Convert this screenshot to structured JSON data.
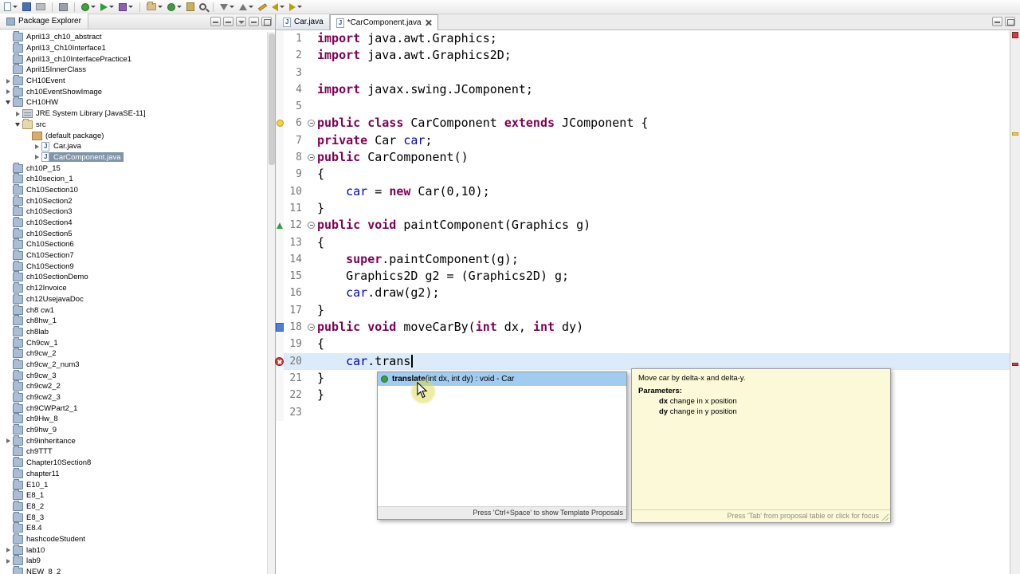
{
  "toolbar": {
    "icons": [
      {
        "name": "new-wizard-button",
        "kind": "doc",
        "dd": true
      },
      {
        "name": "save-button",
        "kind": "disk"
      },
      {
        "name": "print-button",
        "kind": "printer"
      },
      {
        "sep": true
      },
      {
        "name": "build-all-button",
        "kind": "hammer"
      },
      {
        "sep": true
      },
      {
        "name": "debug-button",
        "kind": "bug",
        "dd": true
      },
      {
        "name": "run-button",
        "kind": "play",
        "dd": true
      },
      {
        "name": "profile-button",
        "kind": "profile",
        "dd": true
      },
      {
        "sep": true
      },
      {
        "name": "new-java-project-button",
        "kind": "folder",
        "dd": true
      },
      {
        "name": "new-class-button",
        "kind": "class",
        "dd": true
      },
      {
        "name": "open-type-button",
        "kind": "jar"
      },
      {
        "name": "search-button",
        "kind": "search"
      },
      {
        "sep": true
      },
      {
        "name": "next-annotation-button",
        "kind": "arrow-down",
        "dd": true
      },
      {
        "name": "prev-annotation-button",
        "kind": "arrow-up",
        "dd": true
      },
      {
        "name": "last-edit-location-button",
        "kind": "pencil"
      },
      {
        "name": "back-button",
        "kind": "arrow-left",
        "dd": true
      },
      {
        "name": "forward-button",
        "kind": "arrow-right",
        "dd": true
      }
    ]
  },
  "package_explorer": {
    "title": "Package Explorer",
    "items": [
      {
        "label": "April13_ch10_abstract",
        "depth": 0,
        "icon": "project"
      },
      {
        "label": "April13_Ch10Interface1",
        "depth": 0,
        "icon": "project"
      },
      {
        "label": "April13_ch10InterfacePractice1",
        "depth": 0,
        "icon": "project"
      },
      {
        "label": "April15InnerClass",
        "depth": 0,
        "icon": "project"
      },
      {
        "label": "CH10Event",
        "depth": 0,
        "icon": "project",
        "arrow": "right"
      },
      {
        "label": "ch10EventShowImage",
        "depth": 0,
        "icon": "project",
        "arrow": "right"
      },
      {
        "label": "CH10HW",
        "depth": 0,
        "icon": "project",
        "arrow": "down"
      },
      {
        "label": "JRE System Library [JavaSE-11]",
        "depth": 1,
        "icon": "lib",
        "arrow": "right"
      },
      {
        "label": "src",
        "depth": 1,
        "icon": "src",
        "arrow": "down"
      },
      {
        "label": "(default package)",
        "depth": 2,
        "icon": "pkg"
      },
      {
        "label": "Car.java",
        "depth": 3,
        "icon": "jfile",
        "arrow": "right"
      },
      {
        "label": "CarComponent.java",
        "depth": 3,
        "icon": "jfile",
        "arrow": "right",
        "selected": true
      },
      {
        "label": "ch10P_15",
        "depth": 0,
        "icon": "project"
      },
      {
        "label": "ch10secion_1",
        "depth": 0,
        "icon": "project"
      },
      {
        "label": "Ch10Section10",
        "depth": 0,
        "icon": "project"
      },
      {
        "label": "ch10Section2",
        "depth": 0,
        "icon": "project"
      },
      {
        "label": "ch10Section3",
        "depth": 0,
        "icon": "project"
      },
      {
        "label": "ch10Section4",
        "depth": 0,
        "icon": "project"
      },
      {
        "label": "ch10Section5",
        "depth": 0,
        "icon": "project"
      },
      {
        "label": "Ch10Section6",
        "depth": 0,
        "icon": "project"
      },
      {
        "label": "Ch10Section7",
        "depth": 0,
        "icon": "project"
      },
      {
        "label": "Ch10Section9",
        "depth": 0,
        "icon": "project"
      },
      {
        "label": "ch10SectionDemo",
        "depth": 0,
        "icon": "project"
      },
      {
        "label": "ch12Invoice",
        "depth": 0,
        "icon": "project"
      },
      {
        "label": "ch12UsejavaDoc",
        "depth": 0,
        "icon": "project"
      },
      {
        "label": "ch8 cw1",
        "depth": 0,
        "icon": "project"
      },
      {
        "label": "ch8hw_1",
        "depth": 0,
        "icon": "project"
      },
      {
        "label": "ch8lab",
        "depth": 0,
        "icon": "project"
      },
      {
        "label": "Ch9cw_1",
        "depth": 0,
        "icon": "project"
      },
      {
        "label": "ch9cw_2",
        "depth": 0,
        "icon": "project"
      },
      {
        "label": "ch9cw_2_num3",
        "depth": 0,
        "icon": "project"
      },
      {
        "label": "ch9cw_3",
        "depth": 0,
        "icon": "project"
      },
      {
        "label": "ch9cw2_2",
        "depth": 0,
        "icon": "project"
      },
      {
        "label": "ch9cw2_3",
        "depth": 0,
        "icon": "project"
      },
      {
        "label": "ch9CWPart2_1",
        "depth": 0,
        "icon": "project"
      },
      {
        "label": "ch9Hw_8",
        "depth": 0,
        "icon": "project"
      },
      {
        "label": "ch9hw_9",
        "depth": 0,
        "icon": "project"
      },
      {
        "label": "ch9inheritance",
        "depth": 0,
        "icon": "project",
        "arrow": "right"
      },
      {
        "label": "ch9TTT",
        "depth": 0,
        "icon": "project"
      },
      {
        "label": "Chapter10Section8",
        "depth": 0,
        "icon": "project"
      },
      {
        "label": "chapter11",
        "depth": 0,
        "icon": "project"
      },
      {
        "label": "E10_1",
        "depth": 0,
        "icon": "project"
      },
      {
        "label": "E8_1",
        "depth": 0,
        "icon": "project"
      },
      {
        "label": "E8_2",
        "depth": 0,
        "icon": "project"
      },
      {
        "label": "E8_3",
        "depth": 0,
        "icon": "project"
      },
      {
        "label": "E8.4",
        "depth": 0,
        "icon": "project"
      },
      {
        "label": "hashcodeStudent",
        "depth": 0,
        "icon": "project"
      },
      {
        "label": "lab10",
        "depth": 0,
        "icon": "project",
        "arrow": "right"
      },
      {
        "label": "lab9",
        "depth": 0,
        "icon": "project",
        "arrow": "right"
      },
      {
        "label": "NEW_8_2",
        "depth": 0,
        "icon": "project"
      }
    ]
  },
  "editor": {
    "tabs": [
      {
        "label": "Car.java",
        "active": false
      },
      {
        "label": "*CarComponent.java",
        "active": true
      }
    ],
    "lines": [
      {
        "n": 1,
        "tokens": [
          {
            "t": "k",
            "s": "import"
          },
          {
            "t": "p",
            "s": " java.awt.Graphics;"
          }
        ]
      },
      {
        "n": 2,
        "tokens": [
          {
            "t": "k",
            "s": "import"
          },
          {
            "t": "p",
            "s": " java.awt.Graphics2D;"
          }
        ]
      },
      {
        "n": 3,
        "tokens": []
      },
      {
        "n": 4,
        "tokens": [
          {
            "t": "k",
            "s": "import"
          },
          {
            "t": "p",
            "s": " javax.swing.JComponent;"
          }
        ]
      },
      {
        "n": 5,
        "tokens": []
      },
      {
        "n": 6,
        "tokens": [
          {
            "t": "k",
            "s": "public"
          },
          {
            "t": "p",
            "s": " "
          },
          {
            "t": "k",
            "s": "class"
          },
          {
            "t": "p",
            "s": " CarComponent "
          },
          {
            "t": "k",
            "s": "extends"
          },
          {
            "t": "p",
            "s": " JComponent {"
          }
        ],
        "fold": true,
        "marker": "warning"
      },
      {
        "n": 7,
        "tokens": [
          {
            "t": "k",
            "s": "private"
          },
          {
            "t": "p",
            "s": " Car "
          },
          {
            "t": "f",
            "s": "car"
          },
          {
            "t": "p",
            "s": ";"
          }
        ]
      },
      {
        "n": 8,
        "tokens": [
          {
            "t": "k",
            "s": "public"
          },
          {
            "t": "p",
            "s": " CarComponent()"
          }
        ],
        "fold": true
      },
      {
        "n": 9,
        "tokens": [
          {
            "t": "p",
            "s": "{"
          }
        ]
      },
      {
        "n": 10,
        "tokens": [
          {
            "t": "p",
            "s": "    "
          },
          {
            "t": "f",
            "s": "car"
          },
          {
            "t": "p",
            "s": " = "
          },
          {
            "t": "k",
            "s": "new"
          },
          {
            "t": "p",
            "s": " Car(0,10);"
          }
        ]
      },
      {
        "n": 11,
        "tokens": [
          {
            "t": "p",
            "s": "}"
          }
        ]
      },
      {
        "n": 12,
        "tokens": [
          {
            "t": "k",
            "s": "public"
          },
          {
            "t": "p",
            "s": " "
          },
          {
            "t": "k",
            "s": "void"
          },
          {
            "t": "p",
            "s": " paintComponent(Graphics g)"
          }
        ],
        "fold": true,
        "marker": "override"
      },
      {
        "n": 13,
        "tokens": [
          {
            "t": "p",
            "s": "{"
          }
        ]
      },
      {
        "n": 14,
        "tokens": [
          {
            "t": "p",
            "s": "    "
          },
          {
            "t": "k",
            "s": "super"
          },
          {
            "t": "p",
            "s": ".paintComponent(g);"
          }
        ]
      },
      {
        "n": 15,
        "tokens": [
          {
            "t": "p",
            "s": "    Graphics2D g2 = (Graphics2D) g;"
          }
        ]
      },
      {
        "n": 16,
        "tokens": [
          {
            "t": "p",
            "s": "    "
          },
          {
            "t": "f",
            "s": "car"
          },
          {
            "t": "p",
            "s": ".draw(g2);"
          }
        ]
      },
      {
        "n": 17,
        "tokens": [
          {
            "t": "p",
            "s": "}"
          }
        ]
      },
      {
        "n": 18,
        "tokens": [
          {
            "t": "k",
            "s": "public"
          },
          {
            "t": "p",
            "s": " "
          },
          {
            "t": "k",
            "s": "void"
          },
          {
            "t": "p",
            "s": " moveCarBy("
          },
          {
            "t": "k",
            "s": "int"
          },
          {
            "t": "p",
            "s": " dx, "
          },
          {
            "t": "k",
            "s": "int"
          },
          {
            "t": "p",
            "s": " dy)"
          }
        ],
        "fold": true,
        "marker": "occurrence"
      },
      {
        "n": 19,
        "tokens": [
          {
            "t": "p",
            "s": "{"
          }
        ]
      },
      {
        "n": 20,
        "tokens": [
          {
            "t": "p",
            "s": "    "
          },
          {
            "t": "f",
            "s": "car"
          },
          {
            "t": "p",
            "s": ".trans"
          }
        ],
        "marker": "error",
        "current": true,
        "caret": true
      },
      {
        "n": 21,
        "tokens": [
          {
            "t": "p",
            "s": "}"
          }
        ]
      },
      {
        "n": 22,
        "tokens": [
          {
            "t": "p",
            "s": "}"
          }
        ]
      },
      {
        "n": 23,
        "tokens": []
      }
    ]
  },
  "completion": {
    "items": [
      {
        "bold_prefix": "translate",
        "rest": "(int dx, int dy) : void - Car",
        "selected": true
      }
    ],
    "footer": "Press 'Ctrl+Space' to show Template Proposals"
  },
  "javadoc": {
    "summary": "Move car by delta-x and delta-y.",
    "parameters_label": "Parameters:",
    "params": [
      {
        "name": "dx",
        "desc": "change in x position"
      },
      {
        "name": "dy",
        "desc": "change in y position"
      }
    ],
    "footer": "Press 'Tab' from proposal table or click for focus"
  },
  "colors": {
    "keyword": "#7f0055",
    "field": "#0000c0",
    "current_line": "#dcebfa",
    "selection": "#a2cbf0",
    "javadoc_bg": "#fbf9d8",
    "error": "#cf3f3f"
  }
}
